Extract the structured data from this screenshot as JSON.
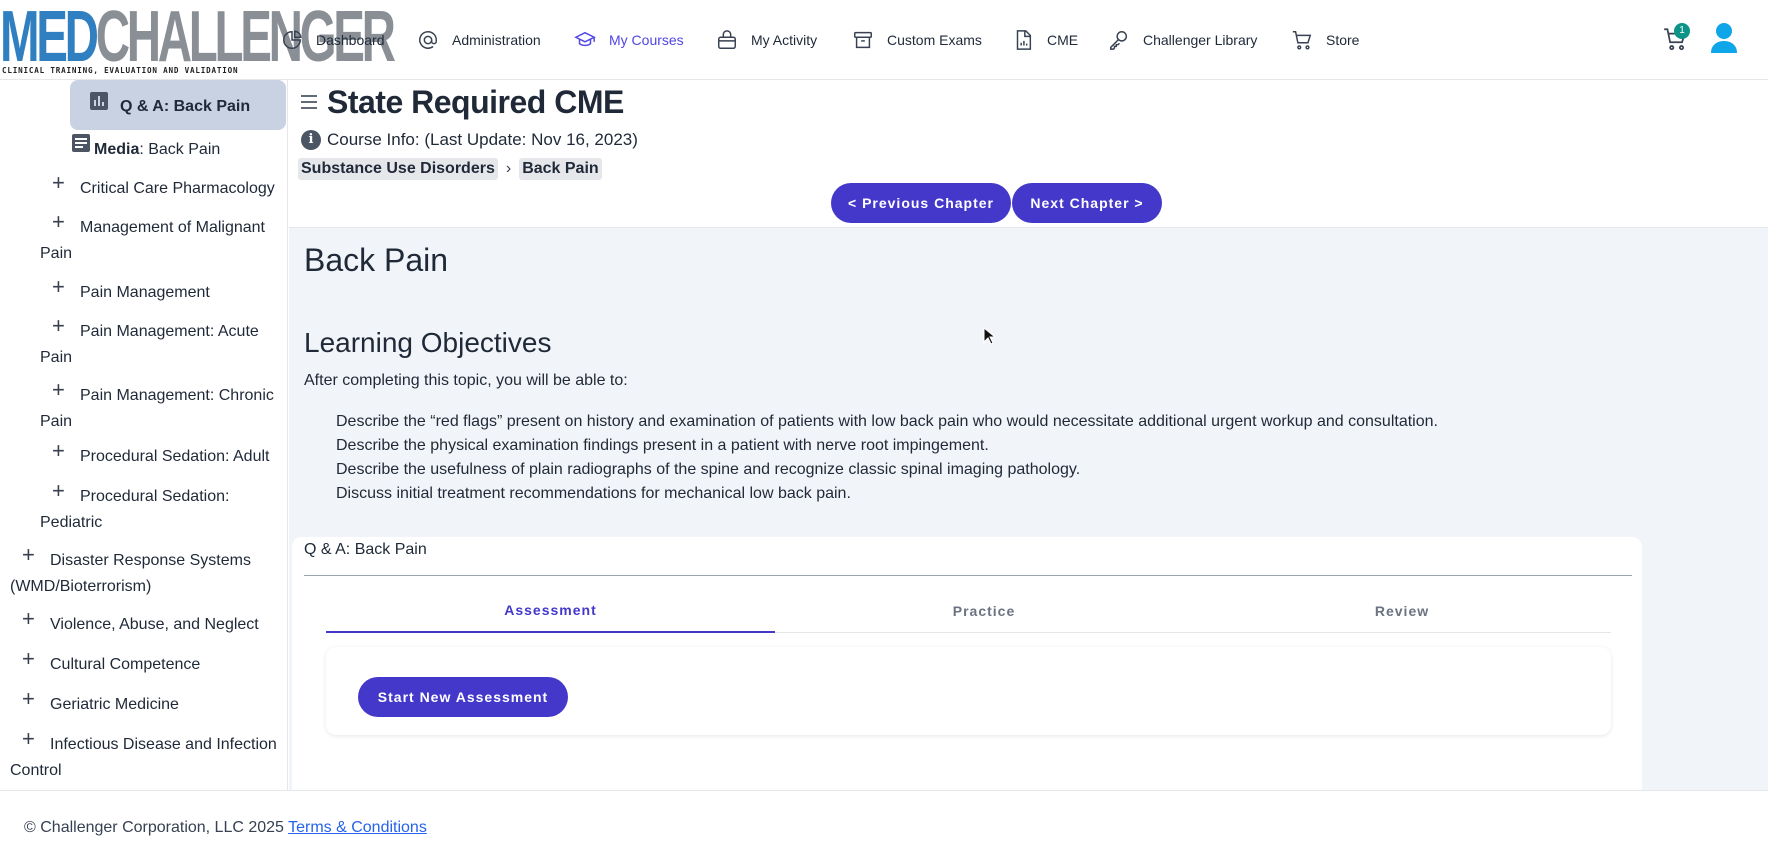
{
  "brand": {
    "logo_part1": "MED",
    "logo_part2": "CHALLENGER",
    "tagline": "CLINICAL TRAINING, EVALUATION AND VALIDATION"
  },
  "nav": {
    "items": [
      {
        "label": "Dashboard",
        "icon": "pie-chart-icon"
      },
      {
        "label": "Administration",
        "icon": "at-sign-icon"
      },
      {
        "label": "My Courses",
        "icon": "graduation-cap-icon",
        "active": true
      },
      {
        "label": "My Activity",
        "icon": "briefcase-icon"
      },
      {
        "label": "Custom Exams",
        "icon": "archive-icon"
      },
      {
        "label": "CME",
        "icon": "document-chart-icon"
      },
      {
        "label": "Challenger Library",
        "icon": "key-icon"
      },
      {
        "label": "Store",
        "icon": "shopping-cart-icon"
      }
    ],
    "cart_count": "1",
    "accent": "#4f46e5"
  },
  "sidebar": {
    "active_item": "Q & A: Back Pain",
    "media_bold": "Media",
    "media_rest": ": Back Pain",
    "sub_items": [
      {
        "line1": "Critical Care Pharmacology",
        "line2": ""
      },
      {
        "line1": "Management of Malignant",
        "line2": "Pain"
      },
      {
        "line1": "Pain Management",
        "line2": ""
      },
      {
        "line1": "Pain Management: Acute",
        "line2": "Pain"
      },
      {
        "line1": "Pain Management: Chronic",
        "line2": "Pain"
      },
      {
        "line1": "Procedural Sedation: Adult",
        "line2": ""
      },
      {
        "line1": "Procedural Sedation:",
        "line2": "Pediatric"
      }
    ],
    "top_items": [
      {
        "line1": "Disaster Response Systems",
        "line2": "(WMD/Bioterrorism)"
      },
      {
        "line1": "Violence, Abuse, and Neglect",
        "line2": ""
      },
      {
        "line1": "Cultural Competence",
        "line2": ""
      },
      {
        "line1": "Geriatric Medicine",
        "line2": ""
      },
      {
        "line1": "Infectious Disease and Infection",
        "line2": "Control"
      }
    ]
  },
  "course": {
    "title": "State Required CME",
    "info": "Course Info: (Last Update: Nov 16, 2023)",
    "breadcrumb": [
      "Substance Use Disorders",
      "Back Pain"
    ],
    "prev_label": "< Previous Chapter",
    "next_label": "Next Chapter >"
  },
  "topic": {
    "title": "Back Pain",
    "lo_heading": "Learning Objectives",
    "lo_intro": "After completing this topic, you will be able to:",
    "objectives": [
      "Describe the “red flags” present on history and examination of patients with low back pain who would necessitate additional urgent workup and consultation.",
      "Describe the physical examination findings present in a patient with nerve root impingement.",
      "Describe the usefulness of plain radiographs of the spine and recognize classic spinal imaging pathology.",
      "Discuss initial treatment recommendations for mechanical low back pain."
    ]
  },
  "qa": {
    "title": "Q & A: Back Pain",
    "tabs": [
      "Assessment",
      "Practice",
      "Review"
    ],
    "active_tab": "Assessment",
    "start_label": "Start New Assessment"
  },
  "footer": {
    "copyright": "© Challenger Corporation, LLC 2025",
    "terms_label": "Terms & Conditions"
  }
}
